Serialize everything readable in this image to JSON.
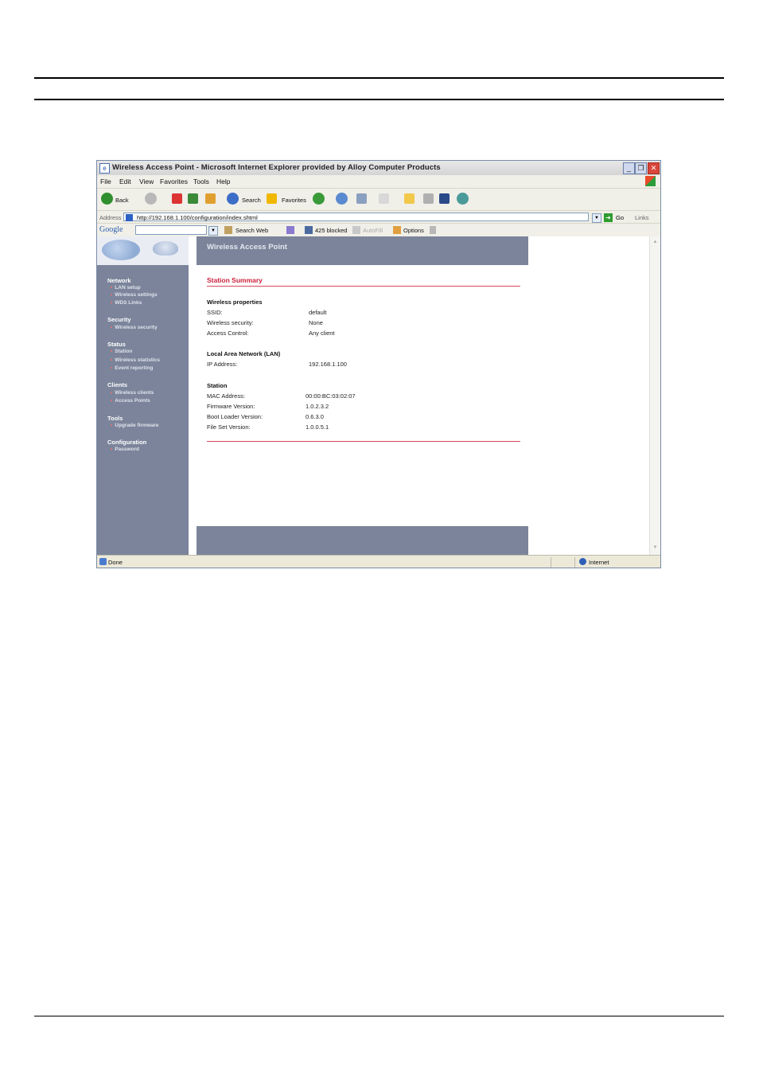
{
  "window": {
    "title": "Wireless Access Point - Microsoft Internet Explorer provided by Alloy Computer Products",
    "buttons": {
      "minimize": "_",
      "maximize": "❐",
      "close": "✕"
    }
  },
  "menu": [
    "File",
    "Edit",
    "View",
    "Favorites",
    "Tools",
    "Help"
  ],
  "toolbar": {
    "back": "Back",
    "search": "Search",
    "favorites": "Favorites"
  },
  "address": {
    "label": "Address",
    "url": "http://192.168.1.100/configuration/index.shtml",
    "go": "Go",
    "links": "Links"
  },
  "google_bar": {
    "logo": "Google",
    "search_web": "Search Web",
    "blocked": "425 blocked",
    "autofill": "AutoFill",
    "options": "Options"
  },
  "page": {
    "header": "Wireless Access Point",
    "nav": [
      {
        "group": "Network",
        "links": [
          "LAN setup",
          "Wireless settings",
          "WDS Links"
        ]
      },
      {
        "group": "Security",
        "links": [
          "Wireless security"
        ]
      },
      {
        "group": "Status",
        "links": [
          "Station",
          "Wireless statistics",
          "Event reporting"
        ]
      },
      {
        "group": "Clients",
        "links": [
          "Wireless clients",
          "Access Points"
        ]
      },
      {
        "group": "Tools",
        "links": [
          "Upgrade firmware"
        ]
      },
      {
        "group": "Configuration",
        "links": [
          "Password"
        ]
      }
    ],
    "section_title": "Station Summary",
    "wireless": {
      "title": "Wireless properties",
      "rows": [
        {
          "label": "SSID:",
          "value": "default"
        },
        {
          "label": "Wireless security:",
          "value": "None"
        },
        {
          "label": "Access Control:",
          "value": "Any client"
        }
      ]
    },
    "lan": {
      "title": "Local Area Network (LAN)",
      "rows": [
        {
          "label": "IP Address:",
          "value": "192.168.1.100"
        }
      ]
    },
    "station": {
      "title": "Station",
      "rows": [
        {
          "label": "MAC Address:",
          "value": "00:00:BC:03:02:07"
        },
        {
          "label": "Firmware Version:",
          "value": "1.0.2.3.2"
        },
        {
          "label": "Boot Loader Version:",
          "value": "0.6.3.0"
        },
        {
          "label": "File Set Version:",
          "value": "1.0.0.5.1"
        }
      ]
    }
  },
  "status": {
    "text": "Done",
    "zone": "Internet"
  }
}
